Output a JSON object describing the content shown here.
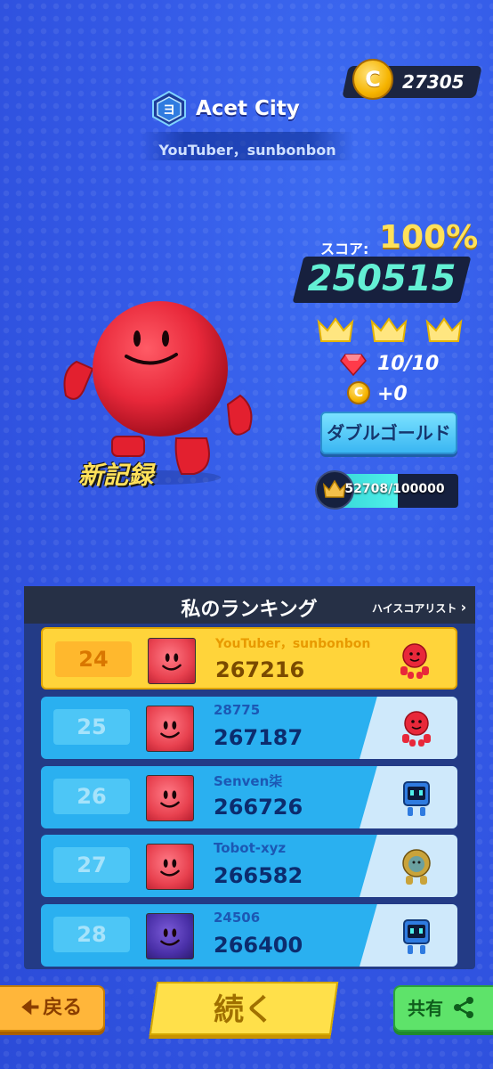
{
  "header": {
    "coins": "27305",
    "coin_symbol": "C",
    "level_badge": "ヨ",
    "city_name": "Acet City",
    "player_name": "YouTuber，sunbonbon"
  },
  "result": {
    "score_label": "スコア:",
    "score_percent": "100%",
    "score_value": "250515",
    "crowns_earned": 3,
    "gems": "10/10",
    "coin_gain": "+0",
    "double_gold_label": "ダブルゴールド",
    "xp_text": "52708/100000",
    "xp_fraction": 0.527,
    "new_record_label": "新記録"
  },
  "ranking": {
    "title": "私のランキング",
    "highscore_link": "ハイスコアリスト",
    "rows": [
      {
        "rank": "24",
        "name": "YouTuber，sunbonbon",
        "score": "267216",
        "avatar": "red",
        "char": "red-octo",
        "me": true
      },
      {
        "rank": "25",
        "name": "28775",
        "score": "267187",
        "avatar": "red",
        "char": "red-octo",
        "me": false
      },
      {
        "rank": "26",
        "name": "Senven柒",
        "score": "266726",
        "avatar": "red",
        "char": "blue-robot",
        "me": false
      },
      {
        "rank": "27",
        "name": "Tobot-xyz",
        "score": "266582",
        "avatar": "red",
        "char": "gold-lion",
        "me": false
      },
      {
        "rank": "28",
        "name": "24506",
        "score": "266400",
        "avatar": "purple",
        "char": "blue-robot",
        "me": false
      }
    ]
  },
  "buttons": {
    "back_label": "戻る",
    "continue_label": "続く",
    "share_label": "共有"
  },
  "colors": {
    "background": "#3459e6",
    "score_teal": "#63f0d4",
    "gold": "#ffe15a",
    "me_row": "#ffd43a",
    "other_row": "#2ab0f0"
  }
}
